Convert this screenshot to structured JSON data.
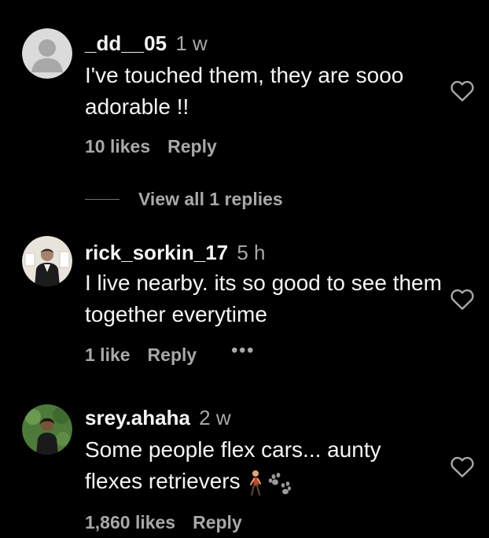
{
  "comments": [
    {
      "username": "_dd__05",
      "time": "1 w",
      "text": "I've touched them, they are sooo adorable !!",
      "likes": "10 likes",
      "reply": "Reply",
      "avatar": "default-avatar"
    },
    {
      "username": "rick_sorkin_17",
      "time": "5 h",
      "text": "I live nearby. its so good to see them together everytime",
      "likes": "1 like",
      "reply": "Reply",
      "more": "•••",
      "avatar": "photo-avatar"
    },
    {
      "username": "srey.ahaha",
      "time": "2 w",
      "text": "Some people flex cars... aunty flexes retrievers",
      "emoji_icons": [
        "person-walking-icon",
        "paw-prints-icon"
      ],
      "likes": "1,860 likes",
      "reply": "Reply",
      "avatar": "photo-avatar"
    }
  ],
  "view_replies": {
    "label": "View all 1 replies"
  },
  "colors": {
    "background": "#000000",
    "primary_text": "#f5f5f5",
    "secondary_text": "#a8a8a8"
  }
}
